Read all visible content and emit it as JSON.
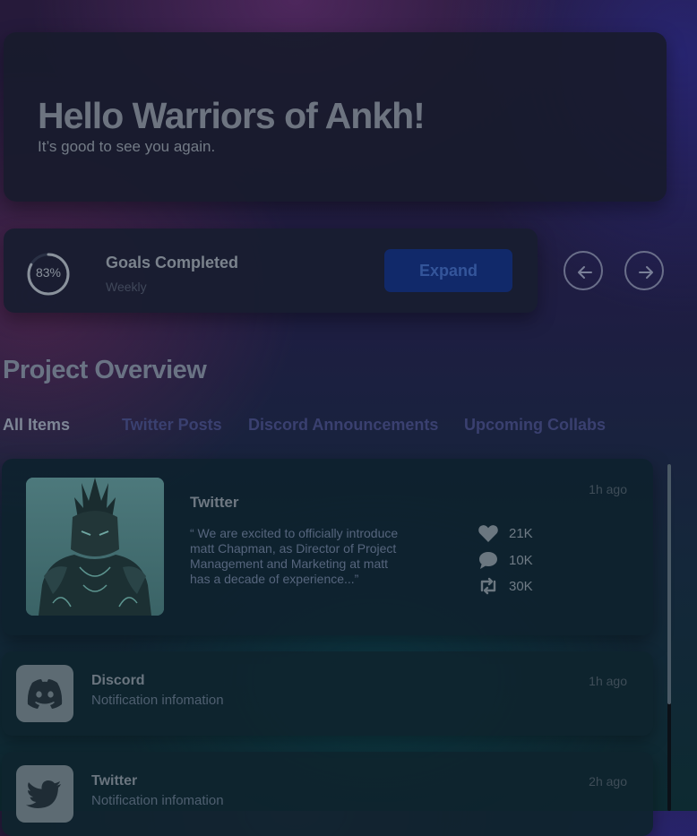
{
  "hero": {
    "title": "Hello Warriors of Ankh!",
    "subtitle": "It’s good to see you again."
  },
  "goals": {
    "percent_text": "83%",
    "progress": 0.83,
    "title": "Goals Completed",
    "period": "Weekly",
    "expand_label": "Expand"
  },
  "nav": {
    "prev_icon": "arrow-left-icon",
    "next_icon": "arrow-right-icon"
  },
  "overview": {
    "title": "Project Overview",
    "tabs": [
      {
        "label": "All Items",
        "active": true
      },
      {
        "label": "Twitter Posts",
        "active": false
      },
      {
        "label": "Discord Announcements",
        "active": false
      },
      {
        "label": "Upcoming Collabs",
        "active": false
      }
    ]
  },
  "feed": {
    "featured": {
      "platform": "Twitter",
      "time": "1h ago",
      "quote": "“ We are excited to officially introduce matt Chapman, as Director of Project Management and Marketing at matt has a decade of experience...”",
      "stats": [
        {
          "icon": "heart-icon",
          "value": "21K"
        },
        {
          "icon": "comment-icon",
          "value": "10K"
        },
        {
          "icon": "retweet-icon",
          "value": "30K"
        }
      ]
    },
    "notifications": [
      {
        "icon": "discord-icon",
        "title": "Discord",
        "subtitle": "Notification infomation",
        "time": "1h ago"
      },
      {
        "icon": "twitter-icon",
        "title": "Twitter",
        "subtitle": "Notification infomation",
        "time": "2h ago"
      }
    ]
  },
  "colors": {
    "accent": "#11296a",
    "card": "#18223a",
    "background": "#1e1d42"
  }
}
